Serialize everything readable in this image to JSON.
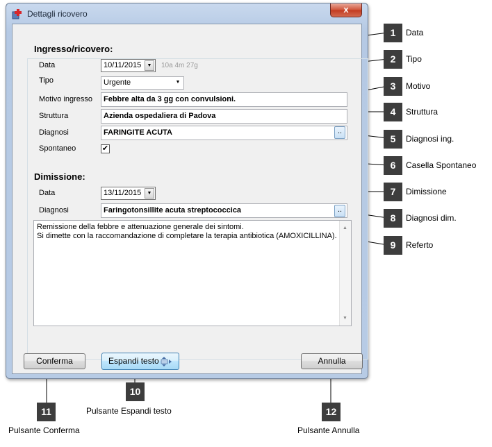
{
  "window": {
    "title": "Dettagli ricovero",
    "close_label": "x"
  },
  "admission": {
    "section_title": "Ingresso/ricovero:",
    "date_label": "Data",
    "date_value": "10/11/2015",
    "duration": "10a 4m 27g",
    "type_label": "Tipo",
    "type_value": "Urgente",
    "reason_label": "Motivo ingresso",
    "reason_value": "Febbre alta da 3 gg con convulsioni.",
    "facility_label": "Struttura",
    "facility_value": "Azienda ospedaliera di Padova",
    "diagnosis_label": "Diagnosi",
    "diagnosis_value": "FARINGITE ACUTA",
    "spontaneous_label": "Spontaneo",
    "spontaneous_checked": true
  },
  "discharge": {
    "section_title": "Dimissione:",
    "date_label": "Data",
    "date_value": "13/11/2015",
    "diagnosis_label": "Diagnosi",
    "diagnosis_value": "Faringotonsillite acuta streptococcica",
    "report_line1": "Remissione della febbre e attenuazione generale dei sintomi.",
    "report_line2": "Si dimette con la raccomandazione di completare la terapia antibiotica (AMOXICILLINA)."
  },
  "buttons": {
    "ellipsis": "..",
    "confirm": "Conferma",
    "expand": "Espandi testo",
    "cancel": "Annulla"
  },
  "callouts": [
    {
      "num": "1",
      "label": "Data"
    },
    {
      "num": "2",
      "label": "Tipo"
    },
    {
      "num": "3",
      "label": "Motivo"
    },
    {
      "num": "4",
      "label": "Struttura"
    },
    {
      "num": "5",
      "label": "Diagnosi ing."
    },
    {
      "num": "6",
      "label": "Casella Spontaneo"
    },
    {
      "num": "7",
      "label": "Dimissione"
    },
    {
      "num": "8",
      "label": "Diagnosi dim."
    },
    {
      "num": "9",
      "label": "Referto"
    },
    {
      "num": "10",
      "label": "Pulsante Espandi testo"
    },
    {
      "num": "11",
      "label": "Pulsante Conferma"
    },
    {
      "num": "12",
      "label": "Pulsante Annulla"
    }
  ],
  "colors": {
    "callout_bg": "#3d3d3d",
    "close_red": "#c23a20",
    "window_frame": "#b7cbe5"
  }
}
